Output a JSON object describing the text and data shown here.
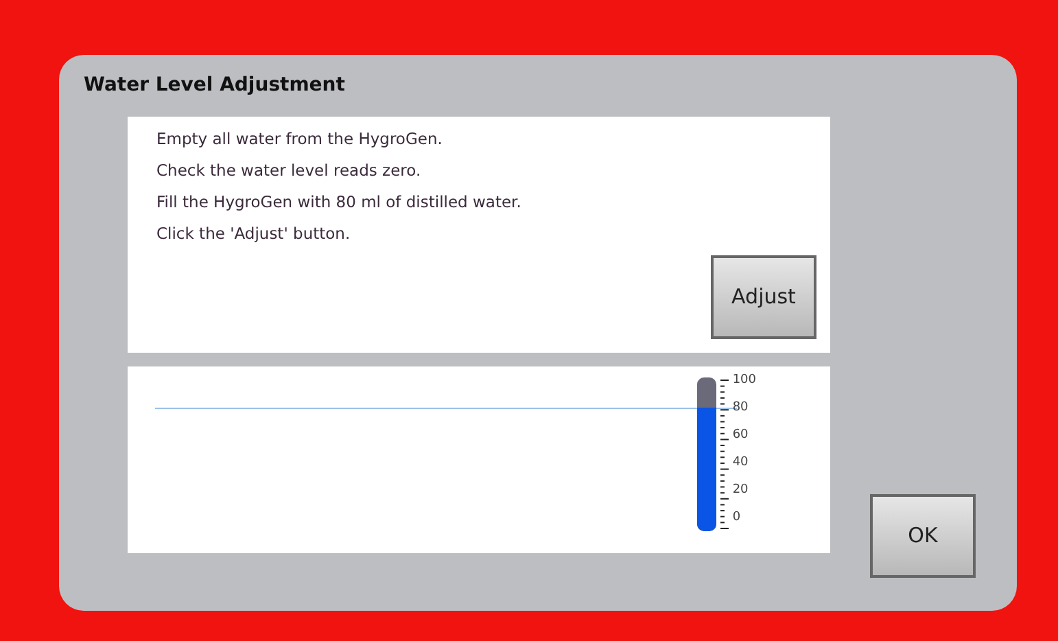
{
  "dialog": {
    "title": "Water Level Adjustment"
  },
  "instructions": [
    "Empty all water from the HygroGen.",
    "Check the water level reads zero.",
    "Fill the HygroGen with 80 ml of distilled water.",
    "Click the 'Adjust' button."
  ],
  "adjust_button": {
    "label": "Adjust"
  },
  "water_gauge": {
    "level": 0.8,
    "scale_labels": [
      "100",
      "80",
      "60",
      "40",
      "20",
      "0"
    ]
  },
  "ok_button": {
    "label": "OK"
  }
}
